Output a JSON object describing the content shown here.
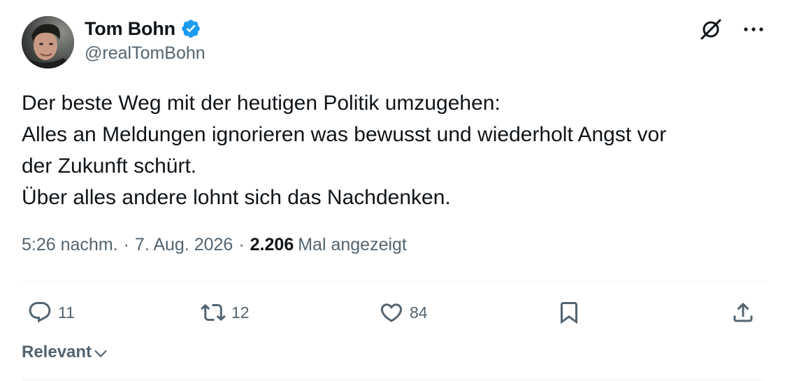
{
  "author": {
    "display_name": "Tom Bohn",
    "handle": "@realTomBohn",
    "verified": true
  },
  "tweet": {
    "lines": [
      "Der beste Weg mit der heutigen Politik umzugehen:",
      "Alles an Meldungen ignorieren was bewusst und wiederholt Angst vor",
      "der Zukunft schürt.",
      "Über alles andere lohnt sich das Nachdenken."
    ]
  },
  "meta": {
    "time": "5:26 nachm.",
    "separator": "·",
    "date": "7. Aug. 2026",
    "views_count": "2.206",
    "views_label": "Mal angezeigt"
  },
  "actions": {
    "replies": "11",
    "reposts": "12",
    "likes": "84"
  },
  "sort": {
    "label": "Relevant"
  },
  "icons": {
    "top_right": [
      "grok-icon",
      "more-icon"
    ],
    "action_bar": [
      "reply-icon",
      "repost-icon",
      "like-icon",
      "bookmark-icon",
      "share-icon"
    ]
  },
  "colors": {
    "verified_blue": "#1d9bf0",
    "secondary_text": "#536471",
    "primary_text": "#0f1419"
  }
}
